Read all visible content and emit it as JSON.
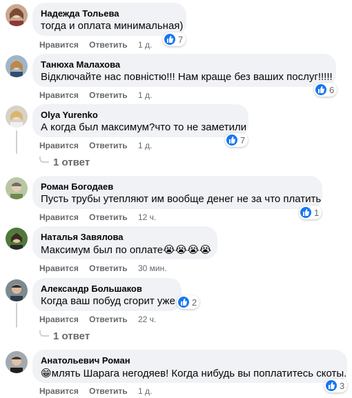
{
  "accent_color": "#1877f2",
  "comments": [
    {
      "author": "Надежда Тольева",
      "text": "тогда и оплата минимальная)",
      "like": "Нравится",
      "reply": "Ответить",
      "time": "1 д.",
      "reactions": "7"
    },
    {
      "author": "Танюха Малахова",
      "text": "Відключайте нас повністю!!! Нам краще без ваших послуг!!!!!",
      "like": "Нравится",
      "reply": "Ответить",
      "time": "1 д.",
      "reactions": "6"
    },
    {
      "author": "Olya Yurenko",
      "text": "А когда был максимум?что то не заметили",
      "like": "Нравится",
      "reply": "Ответить",
      "time": "1 д.",
      "reactions": "7",
      "replies_label": "1 ответ"
    },
    {
      "author": "Роман Богодаев",
      "text": "Пусть трубы утепляют им вообще денег не за что платить",
      "like": "Нравится",
      "reply": "Ответить",
      "time": "12 ч.",
      "reactions": "1"
    },
    {
      "author": "Наталья Завялова",
      "text": "Максимум был по оплате",
      "emoji": "😭😭😭😭",
      "like": "Нравится",
      "reply": "Ответить",
      "time": "30 мин."
    },
    {
      "author": "Александр Большаков",
      "text": "Когда ваш побуд сгорит уже",
      "like": "Нравится",
      "reply": "Ответить",
      "time": "22 ч.",
      "reactions": "2",
      "replies_label": "1 ответ"
    },
    {
      "author": "Анатольевич Роман",
      "emoji": "😁",
      "text": "млять Шарага негодяев! Когда нибудь вы поплатитесь скоты.",
      "like": "Нравится",
      "reply": "Ответить",
      "time": "1 д.",
      "reactions": "3"
    }
  ]
}
